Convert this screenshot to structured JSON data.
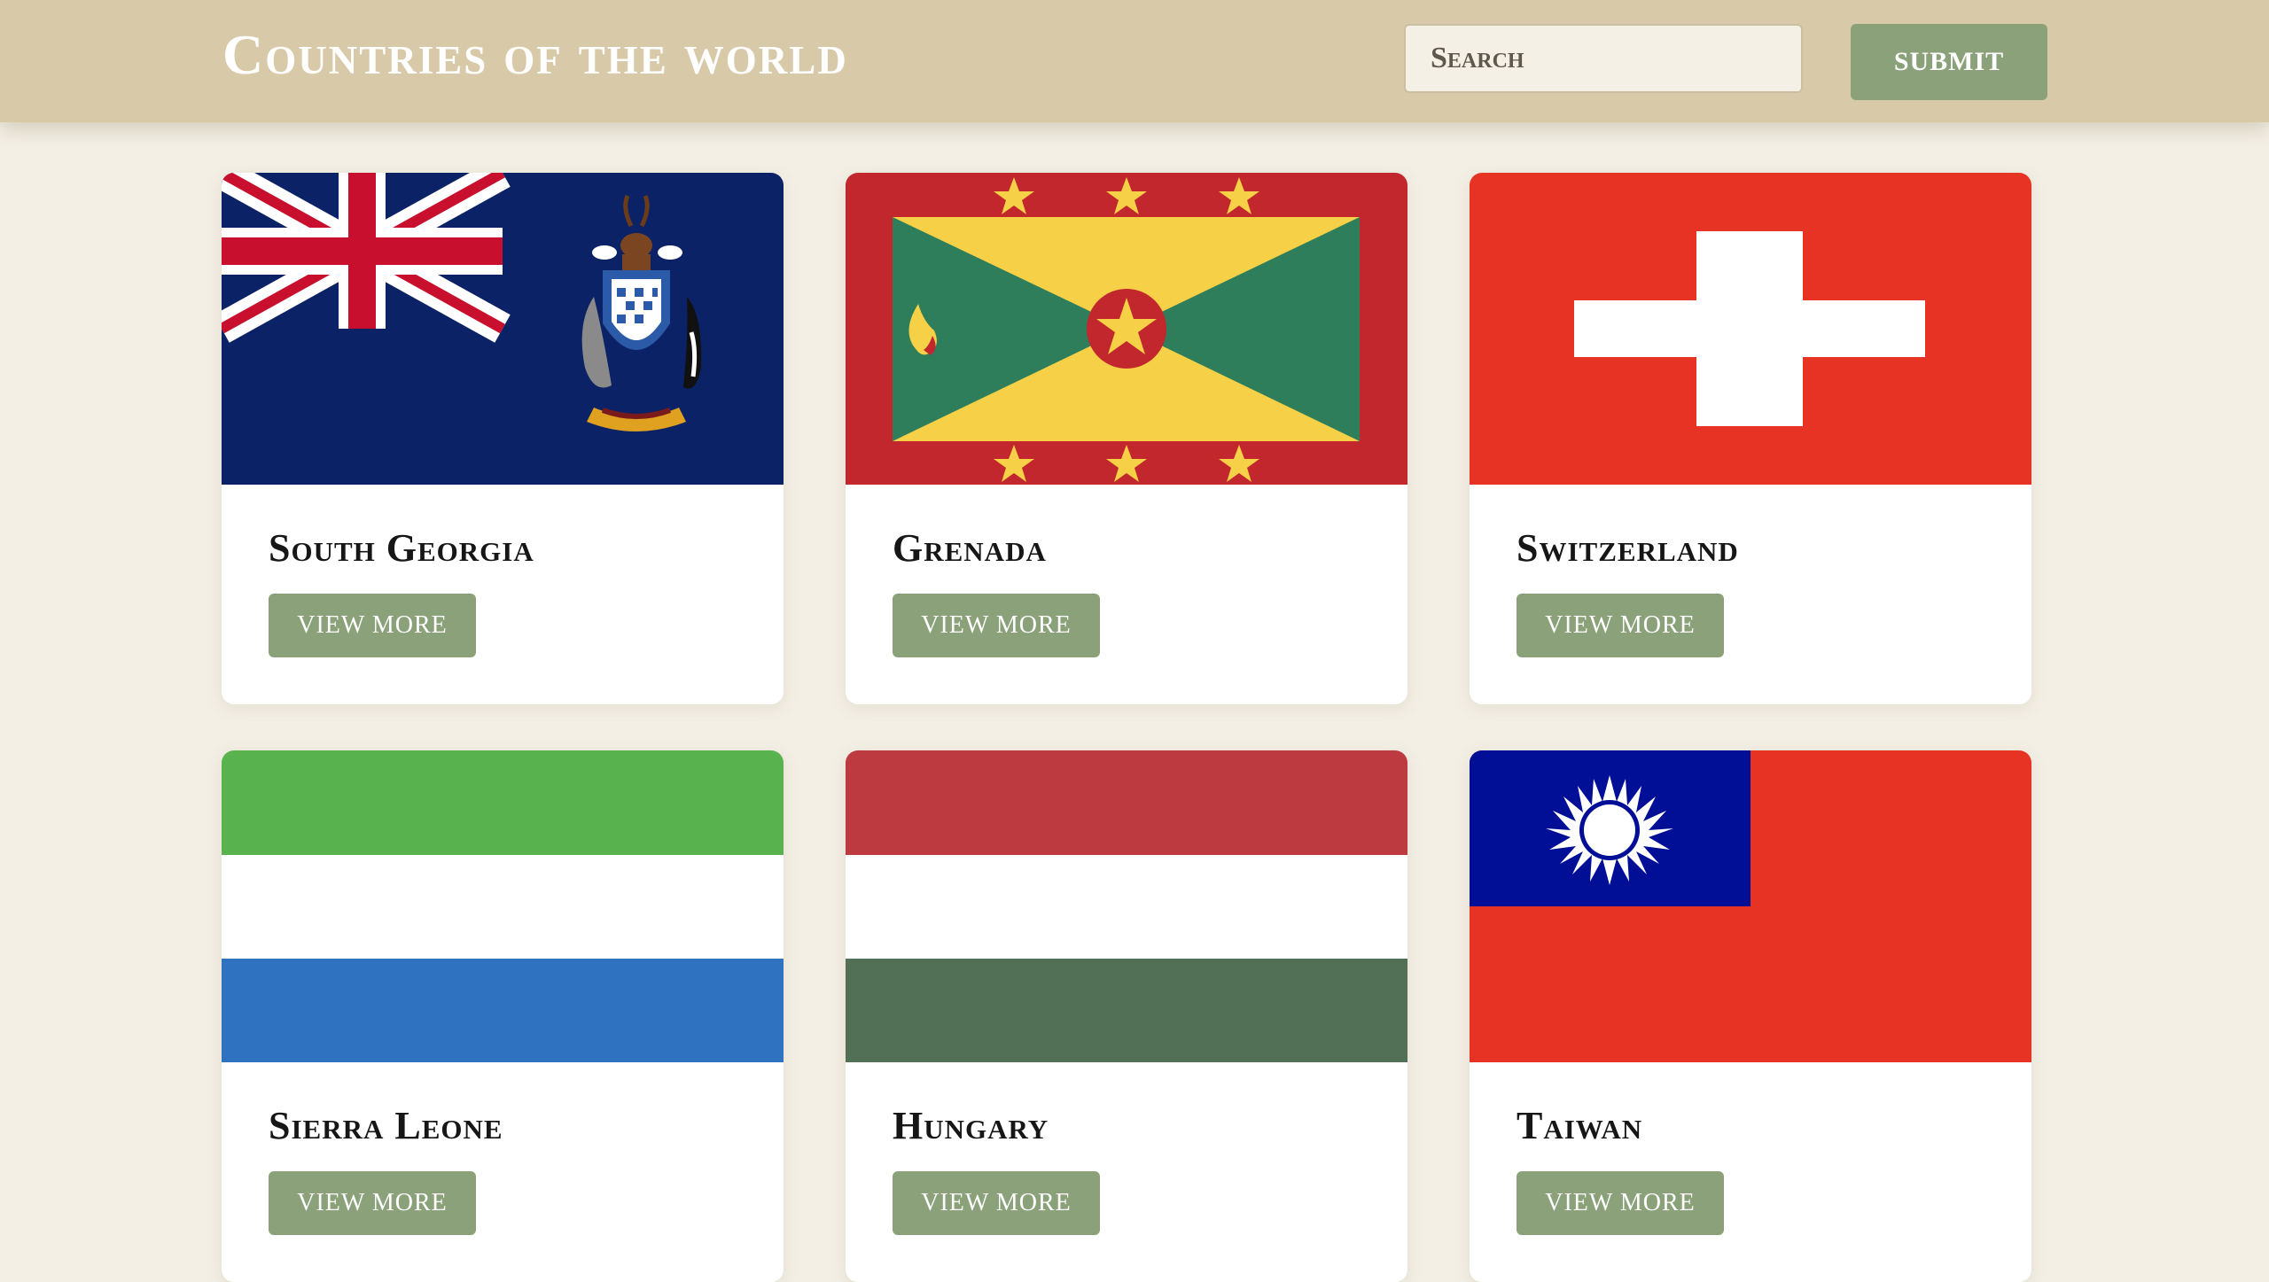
{
  "header": {
    "title": "Countries of the world",
    "search_placeholder": "Search",
    "submit_label": "SUBMIT"
  },
  "colors": {
    "header_bg": "#d8c9a8",
    "page_bg": "#f3efe5",
    "button_green": "#8aa17a"
  },
  "countries": [
    {
      "name": "South Georgia",
      "button": "VIEW MORE",
      "flag": "south-georgia-flag"
    },
    {
      "name": "Grenada",
      "button": "VIEW MORE",
      "flag": "grenada-flag"
    },
    {
      "name": "Switzerland",
      "button": "VIEW MORE",
      "flag": "switzerland-flag"
    },
    {
      "name": "Sierra Leone",
      "button": "VIEW MORE",
      "flag": "sierra-leone-flag"
    },
    {
      "name": "Hungary",
      "button": "VIEW MORE",
      "flag": "hungary-flag"
    },
    {
      "name": "Taiwan",
      "button": "VIEW MORE",
      "flag": "taiwan-flag"
    }
  ]
}
